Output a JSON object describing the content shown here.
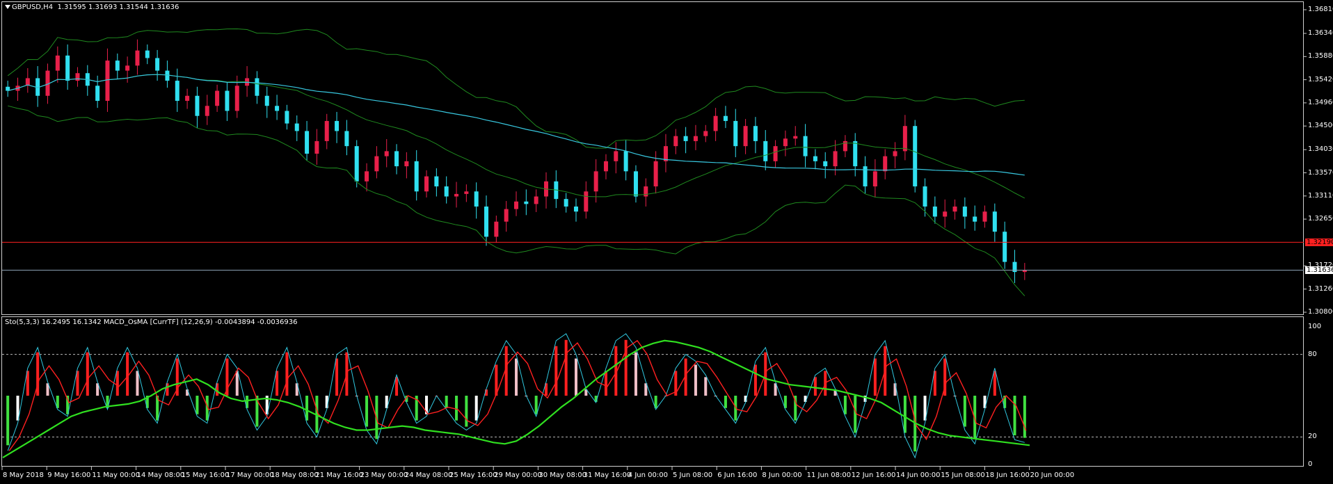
{
  "main_legend": {
    "symbol": "GBPUSD,H4",
    "ohlc": "1.31595 1.31693 1.31544 1.31636"
  },
  "sub_legend": {
    "text": "Sto(5,3,3) 16.2495 16.1342   MACD_OsMA [CurrTF] (12,26,9) -0.0043894 -0.0036936"
  },
  "price_axis": [
    "1.36810",
    "1.36340",
    "1.35880",
    "1.35420",
    "1.34960",
    "1.34500",
    "1.34030",
    "1.33570",
    "1.33110",
    "1.32650",
    "1.31720",
    "1.31260",
    "1.30800"
  ],
  "current_price": "1.31636",
  "red_line_price": "1.32190",
  "sub_axis": [
    "100",
    "80",
    "20",
    "0"
  ],
  "time_axis": [
    "8 May 2018",
    "9 May 16:00",
    "11 May 00:00",
    "14 May 08:00",
    "15 May 16:00",
    "17 May 00:00",
    "18 May 08:00",
    "21 May 16:00",
    "23 May 00:00",
    "24 May 08:00",
    "25 May 16:00",
    "29 May 00:00",
    "30 May 08:00",
    "31 May 16:00",
    "4 Jun 00:00",
    "5 Jun 08:00",
    "6 Jun 16:00",
    "8 Jun 00:00",
    "11 Jun 08:00",
    "12 Jun 16:00",
    "14 Jun 00:00",
    "15 Jun 08:00",
    "18 Jun 16:00",
    "20 Jun 00:00"
  ],
  "colors": {
    "bull": "#e8204a",
    "bear": "#30e0f0",
    "ma": "#38c8e0",
    "bands": "#1f8a1f",
    "red_line": "#ff2020",
    "sto_main": "#30c8e0",
    "sto_sig": "#ff2020",
    "slow": "#30e020",
    "osma_pos_up": "#ff2020",
    "osma_pos_dn": "#f0c0c8",
    "osma_neg_dn": "#40e040",
    "osma_neg_up": "#ffffff"
  },
  "chart_data": {
    "type": "candlestick",
    "close_series": [
      1.352,
      1.353,
      1.3545,
      1.351,
      1.356,
      1.359,
      1.354,
      1.3555,
      1.353,
      1.35,
      1.358,
      1.356,
      1.357,
      1.36,
      1.3585,
      1.356,
      1.354,
      1.35,
      1.351,
      1.347,
      1.349,
      1.352,
      1.348,
      1.353,
      1.3545,
      1.351,
      1.349,
      1.348,
      1.3455,
      1.344,
      1.3395,
      1.342,
      1.346,
      1.344,
      1.341,
      1.334,
      1.336,
      1.339,
      1.34,
      1.337,
      1.338,
      1.332,
      1.335,
      1.333,
      1.331,
      1.3315,
      1.332,
      1.329,
      1.323,
      1.326,
      1.3285,
      1.33,
      1.3295,
      1.331,
      1.334,
      1.3305,
      1.329,
      1.328,
      1.332,
      1.336,
      1.338,
      1.34,
      1.336,
      1.331,
      1.333,
      1.338,
      1.341,
      1.343,
      1.342,
      1.343,
      1.344,
      1.347,
      1.346,
      1.341,
      1.345,
      1.342,
      1.338,
      1.341,
      1.3425,
      1.343,
      1.339,
      1.338,
      1.337,
      1.34,
      1.342,
      1.337,
      1.333,
      1.336,
      1.339,
      1.34,
      1.345,
      1.333,
      1.329,
      1.327,
      1.328,
      1.329,
      1.327,
      1.326,
      1.328,
      1.324,
      1.318,
      1.316,
      1.3164
    ],
    "sto_main": [
      10,
      30,
      70,
      85,
      60,
      40,
      35,
      70,
      85,
      60,
      40,
      70,
      85,
      70,
      40,
      30,
      60,
      80,
      55,
      35,
      30,
      60,
      80,
      70,
      40,
      25,
      35,
      70,
      85,
      60,
      30,
      20,
      40,
      80,
      85,
      50,
      25,
      15,
      40,
      65,
      45,
      30,
      35,
      50,
      40,
      30,
      25,
      30,
      55,
      75,
      90,
      80,
      50,
      35,
      60,
      90,
      95,
      80,
      55,
      45,
      70,
      90,
      95,
      85,
      60,
      40,
      50,
      70,
      80,
      75,
      65,
      50,
      40,
      30,
      45,
      75,
      85,
      60,
      40,
      30,
      45,
      65,
      70,
      55,
      35,
      20,
      45,
      80,
      90,
      60,
      20,
      5,
      30,
      70,
      80,
      50,
      25,
      15,
      40,
      70,
      40,
      18,
      16
    ],
    "slow": [
      5,
      10,
      15,
      20,
      25,
      30,
      35,
      38,
      40,
      42,
      43,
      44,
      46,
      50,
      55,
      58,
      60,
      62,
      58,
      52,
      48,
      46,
      47,
      48,
      47,
      45,
      42,
      38,
      34,
      30,
      27,
      25,
      25,
      26,
      27,
      28,
      27,
      25,
      24,
      23,
      22,
      20,
      18,
      16,
      15,
      17,
      22,
      28,
      35,
      42,
      48,
      55,
      62,
      68,
      74,
      80,
      85,
      88,
      90,
      89,
      87,
      85,
      82,
      78,
      74,
      70,
      66,
      62,
      60,
      58,
      57,
      56,
      55,
      54,
      52,
      50,
      48,
      45,
      40,
      35,
      30,
      26,
      23,
      21,
      20,
      19,
      18,
      17,
      16,
      15,
      14
    ]
  }
}
